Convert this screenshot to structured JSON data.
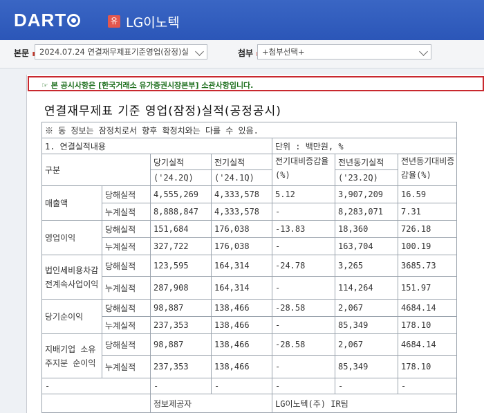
{
  "header": {
    "logo_text": "DART",
    "badge": "유",
    "company": "LG이노텍"
  },
  "toolbar": {
    "main_label": "본문",
    "main_value": "2024.07.24  연결재무제표기준영업(잠정)실",
    "attach_label": "첨부",
    "attach_value": "+첨부선택+"
  },
  "notice": "☞ 본 공시사항은 [한국거래소 유가증권시장본부] 소관사항입니다.",
  "doc_title": "연결재무제표 기준 영업(잠정)실적(공정공시)",
  "table": {
    "note": "※ 동 정보는 잠정치로서 향후 확정치와는 다를 수 있음.",
    "section": "1. 연결실적내용",
    "unit": "단위 : 백만원, %",
    "header": {
      "category": "구분",
      "current": "당기실적",
      "current_period": "('24.2Q)",
      "previous": "전기실적",
      "previous_period": "('24.1Q)",
      "qoq": "전기대비증감율(%)",
      "yoy_actual": "전년동기실적",
      "yoy_period": "('23.2Q)",
      "yoy_rate": "전년동기대비증감율(%)"
    },
    "groups": [
      {
        "name": "매출액",
        "rows": [
          {
            "type": "당해실적",
            "cur": "4,555,269",
            "prev": "4,333,578",
            "qoq": "5.12",
            "ly": "3,907,209",
            "yoy": "16.59"
          },
          {
            "type": "누계실적",
            "cur": "8,888,847",
            "prev": "4,333,578",
            "qoq": "-",
            "ly": "8,283,071",
            "yoy": "7.31"
          }
        ]
      },
      {
        "name": "영업이익",
        "rows": [
          {
            "type": "당해실적",
            "cur": "151,684",
            "prev": "176,038",
            "qoq": "-13.83",
            "ly": "18,360",
            "yoy": "726.18"
          },
          {
            "type": "누계실적",
            "cur": "327,722",
            "prev": "176,038",
            "qoq": "-",
            "ly": "163,704",
            "yoy": "100.19"
          }
        ]
      },
      {
        "name": "법인세비용차감전계속사업이익",
        "rows": [
          {
            "type": "당해실적",
            "cur": "123,595",
            "prev": "164,314",
            "qoq": "-24.78",
            "ly": "3,265",
            "yoy": "3685.73"
          },
          {
            "type": "누계실적",
            "cur": "287,908",
            "prev": "164,314",
            "qoq": "-",
            "ly": "114,264",
            "yoy": "151.97"
          }
        ]
      },
      {
        "name": "당기순이익",
        "rows": [
          {
            "type": "당해실적",
            "cur": "98,887",
            "prev": "138,466",
            "qoq": "-28.58",
            "ly": "2,067",
            "yoy": "4684.14"
          },
          {
            "type": "누계실적",
            "cur": "237,353",
            "prev": "138,466",
            "qoq": "-",
            "ly": "85,349",
            "yoy": "178.10"
          }
        ]
      },
      {
        "name": "지배기업 소유주지분 순이익",
        "rows": [
          {
            "type": "당해실적",
            "cur": "98,887",
            "prev": "138,466",
            "qoq": "-28.58",
            "ly": "2,067",
            "yoy": "4684.14"
          },
          {
            "type": "누계실적",
            "cur": "237,353",
            "prev": "138,466",
            "qoq": "-",
            "ly": "85,349",
            "yoy": "178.10"
          }
        ]
      }
    ],
    "dash_row": [
      "-",
      "-",
      "-",
      "-",
      "-",
      "-"
    ],
    "provider_label": "정보제공자",
    "provider_value": "LG이노텍(주) IR팀"
  }
}
